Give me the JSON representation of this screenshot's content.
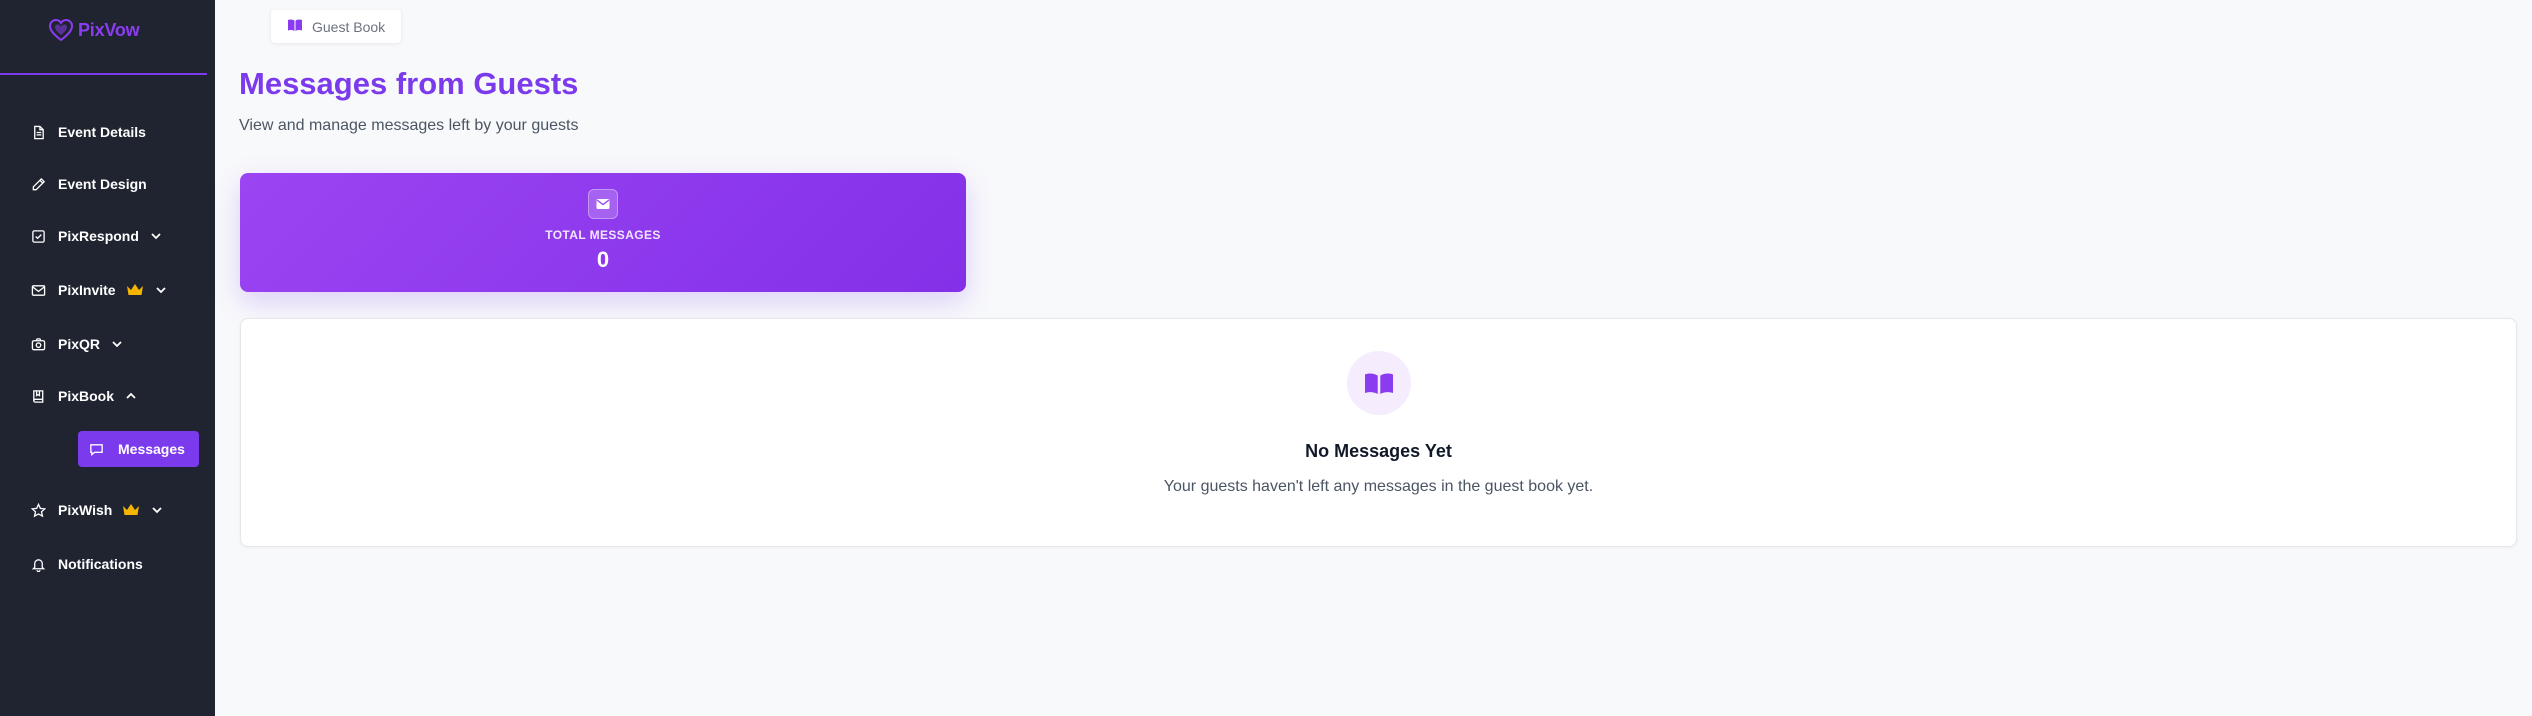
{
  "brand": {
    "name": "PixVow",
    "color": "#7c3aed"
  },
  "sidebar": {
    "items": [
      {
        "label": "Event Details",
        "icon": "document-icon"
      },
      {
        "label": "Event Design",
        "icon": "pen-icon"
      },
      {
        "label": "PixRespond",
        "icon": "checkbox-icon",
        "expanded": false
      },
      {
        "label": "PixInvite",
        "icon": "mail-icon",
        "premium": true,
        "expanded": false
      },
      {
        "label": "PixQR",
        "icon": "camera-icon",
        "expanded": false
      },
      {
        "label": "PixBook",
        "icon": "book-icon",
        "expanded": true
      },
      {
        "label": "PixWish",
        "icon": "star-icon",
        "premium": true,
        "expanded": false
      },
      {
        "label": "Notifications",
        "icon": "bell-icon"
      }
    ],
    "sub_item": {
      "label": "Messages",
      "icon": "message-icon",
      "active": true
    }
  },
  "breadcrumb": {
    "label": "Guest Book",
    "icon": "book-open-icon"
  },
  "page": {
    "title": "Messages from Guests",
    "subtitle": "View and manage messages left by your guests"
  },
  "stats": {
    "label": "TOTAL MESSAGES",
    "value": "0",
    "icon": "mail-icon"
  },
  "empty_state": {
    "icon": "book-open-icon",
    "title": "No Messages Yet",
    "message": "Your guests haven't left any messages in the guest book yet."
  },
  "colors": {
    "sidebar_bg": "#1f2430",
    "accent": "#7c3aed",
    "crown": "#f5b400"
  }
}
